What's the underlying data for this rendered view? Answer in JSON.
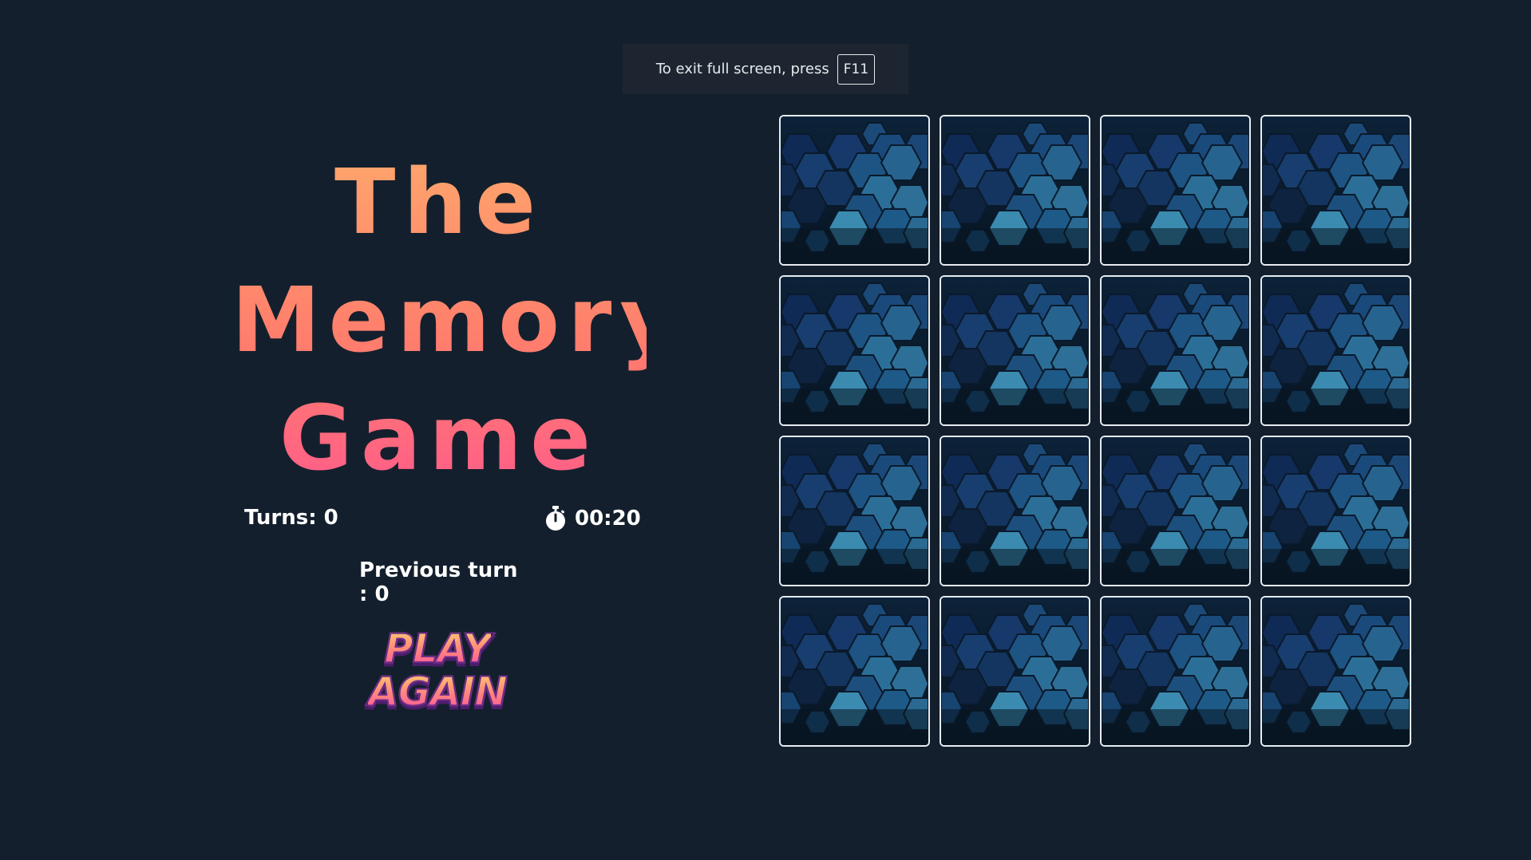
{
  "notice": {
    "text": "To exit full screen, press",
    "key": "F11"
  },
  "title": {
    "line1": "The",
    "line2": "Memory_",
    "line3": "Game"
  },
  "stats": {
    "turns_label": "Turns: 0",
    "timer_icon": "stopwatch-icon",
    "timer_value": "00:20",
    "previous_turn_label": "Previous turn : 0"
  },
  "play_again": {
    "line1": "PLAY",
    "line2": "AGAIN"
  },
  "board": {
    "rows": 4,
    "cols": 4,
    "card_back": "hexagon-pattern",
    "cards": [
      {
        "id": "card-1",
        "state": "face-down"
      },
      {
        "id": "card-2",
        "state": "face-down"
      },
      {
        "id": "card-3",
        "state": "face-down"
      },
      {
        "id": "card-4",
        "state": "face-down"
      },
      {
        "id": "card-5",
        "state": "face-down"
      },
      {
        "id": "card-6",
        "state": "face-down"
      },
      {
        "id": "card-7",
        "state": "face-down"
      },
      {
        "id": "card-8",
        "state": "face-down"
      },
      {
        "id": "card-9",
        "state": "face-down"
      },
      {
        "id": "card-10",
        "state": "face-down"
      },
      {
        "id": "card-11",
        "state": "face-down"
      },
      {
        "id": "card-12",
        "state": "face-down"
      },
      {
        "id": "card-13",
        "state": "face-down"
      },
      {
        "id": "card-14",
        "state": "face-down"
      },
      {
        "id": "card-15",
        "state": "face-down"
      },
      {
        "id": "card-16",
        "state": "face-down"
      }
    ]
  },
  "colors": {
    "background": "#141f2d",
    "title_gradient_top": "#ffa76c",
    "title_gradient_bottom": "#ff5c8a",
    "card_border": "#e6ecf2",
    "hex_light": "#3f8fb0",
    "hex_dark": "#0f2f55"
  }
}
